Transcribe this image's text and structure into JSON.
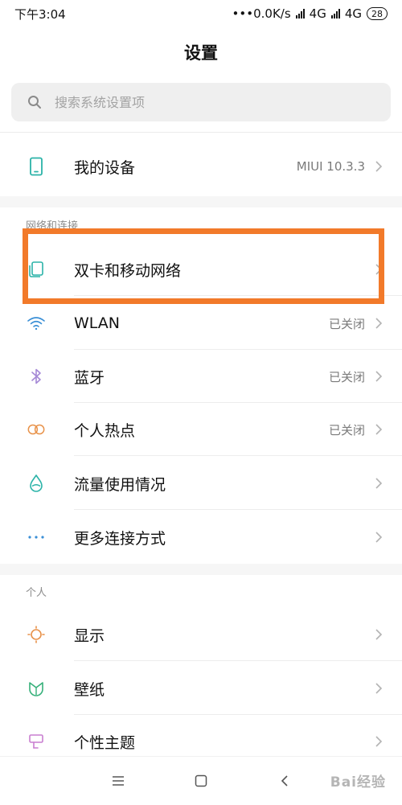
{
  "status_bar": {
    "time": "下午3:04",
    "network_speed": "•••0.0K/s",
    "sim1_type": "4G",
    "sim2_type": "4G",
    "battery": "28"
  },
  "header": {
    "title": "设置"
  },
  "search": {
    "placeholder": "搜索系统设置项"
  },
  "device": {
    "label": "我的设备",
    "value": "MIUI 10.3.3"
  },
  "network_section": {
    "title": "网络和连接",
    "items": [
      {
        "label": "双卡和移动网络",
        "value": "",
        "icon": "sim-card-icon"
      },
      {
        "label": "WLAN",
        "value": "已关闭",
        "icon": "wifi-icon"
      },
      {
        "label": "蓝牙",
        "value": "已关闭",
        "icon": "bluetooth-icon"
      },
      {
        "label": "个人热点",
        "value": "已关闭",
        "icon": "hotspot-icon"
      },
      {
        "label": "流量使用情况",
        "value": "",
        "icon": "data-usage-icon"
      },
      {
        "label": "更多连接方式",
        "value": "",
        "icon": "more-icon"
      }
    ]
  },
  "personal_section": {
    "title": "个人",
    "items": [
      {
        "label": "显示",
        "value": "",
        "icon": "display-icon"
      },
      {
        "label": "壁纸",
        "value": "",
        "icon": "wallpaper-icon"
      },
      {
        "label": "个性主题",
        "value": "",
        "icon": "theme-icon"
      }
    ]
  },
  "watermark": "Bai经验",
  "colors": {
    "highlight": "#f27a2a",
    "icon_teal": "#2bb3a8",
    "icon_purple": "#a588d6",
    "icon_orange": "#e8924a",
    "icon_blue": "#3a8fd6",
    "icon_green": "#36b07a",
    "icon_pink": "#c97fd0"
  }
}
